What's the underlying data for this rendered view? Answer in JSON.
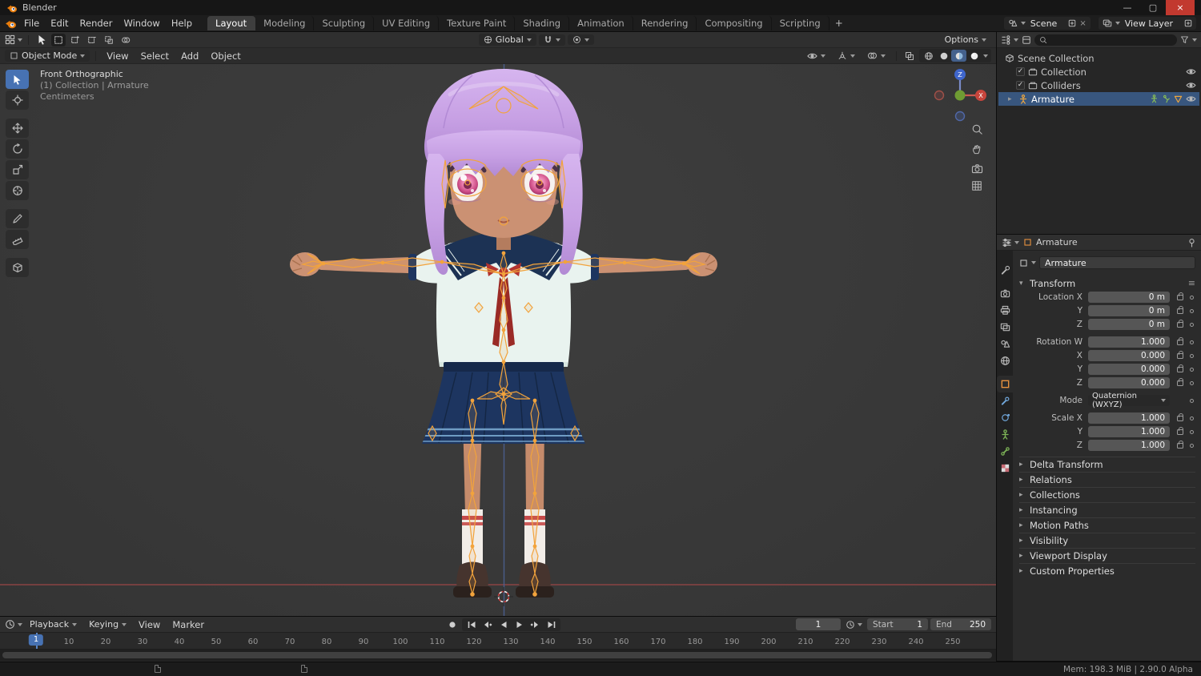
{
  "colors": {
    "accent_blue": "#4772b3",
    "selection_row": "#38567e",
    "armature_orange": "#f2a33c",
    "axis_x_red": "#8a4343",
    "axis_z_blue": "#4d6499",
    "hair_purple": "#c7a0e4",
    "skin_tan": "#cb9173",
    "uniform_navy": "#1d3560",
    "ribbon_red": "#a92f2a",
    "shirt_white": "#e9f3ef"
  },
  "titlebar": {
    "title": "Blender"
  },
  "menubar": {
    "menus": [
      "File",
      "Edit",
      "Render",
      "Window",
      "Help"
    ],
    "workspaces": [
      "Layout",
      "Modeling",
      "Sculpting",
      "UV Editing",
      "Texture Paint",
      "Shading",
      "Animation",
      "Rendering",
      "Compositing",
      "Scripting"
    ],
    "active_workspace": "Layout",
    "add_tab": "+",
    "scene_name": "Scene",
    "view_layer_name": "View Layer"
  },
  "viewport": {
    "tool_row": {
      "orientation": "Global",
      "options": "Options"
    },
    "header_row": {
      "mode": "Object Mode",
      "menus": [
        "View",
        "Select",
        "Add",
        "Object"
      ]
    },
    "overlay": {
      "line1": "Front Orthographic",
      "line2": "(1) Collection | Armature",
      "line3": "Centimeters"
    }
  },
  "outliner": {
    "root": "Scene Collection",
    "items": [
      {
        "label": "Collection"
      },
      {
        "label": "Colliders"
      },
      {
        "label": "Armature"
      }
    ]
  },
  "properties": {
    "breadcrumb": "Armature",
    "name_field": "Armature",
    "transform": {
      "title": "Transform",
      "location": {
        "x_label": "Location X",
        "y_label": "Y",
        "z_label": "Z",
        "x": "0 m",
        "y": "0 m",
        "z": "0 m"
      },
      "rotation": {
        "w_label": "Rotation W",
        "x_label": "X",
        "y_label": "Y",
        "z_label": "Z",
        "w": "1.000",
        "x": "0.000",
        "y": "0.000",
        "z": "0.000"
      },
      "mode_label": "Mode",
      "mode_value": "Quaternion (WXYZ)",
      "scale": {
        "x_label": "Scale X",
        "y_label": "Y",
        "z_label": "Z",
        "x": "1.000",
        "y": "1.000",
        "z": "1.000"
      }
    },
    "panels": [
      "Delta Transform",
      "Relations",
      "Collections",
      "Instancing",
      "Motion Paths",
      "Visibility",
      "Viewport Display",
      "Custom Properties"
    ]
  },
  "timeline": {
    "menus": [
      "Playback",
      "Keying",
      "View",
      "Marker"
    ],
    "current_frame": "1",
    "frame_marker": "1",
    "start_label": "Start",
    "start_value": "1",
    "end_label": "End",
    "end_value": "250",
    "ticks": [
      "10",
      "20",
      "30",
      "40",
      "50",
      "60",
      "70",
      "80",
      "90",
      "100",
      "110",
      "120",
      "130",
      "140",
      "150",
      "160",
      "170",
      "180",
      "190",
      "200",
      "210",
      "220",
      "230",
      "240",
      "250"
    ]
  },
  "statusbar": {
    "info": "Mem: 198.3 MiB | 2.90.0 Alpha"
  }
}
